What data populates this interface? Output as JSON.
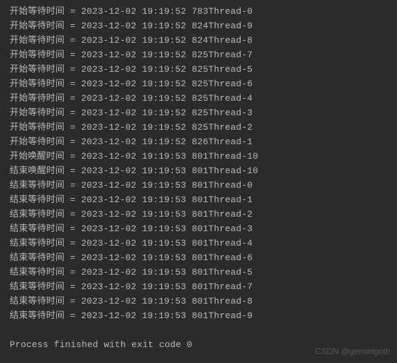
{
  "console": {
    "lines": [
      {
        "label": "开始等待时间",
        "sep": "=",
        "date": "2023-12-02",
        "time": "19:19:52",
        "ms": "783",
        "thread": "Thread-0"
      },
      {
        "label": "开始等待时间",
        "sep": "=",
        "date": "2023-12-02",
        "time": "19:19:52",
        "ms": "824",
        "thread": "Thread-9"
      },
      {
        "label": "开始等待时间",
        "sep": "=",
        "date": "2023-12-02",
        "time": "19:19:52",
        "ms": "824",
        "thread": "Thread-8"
      },
      {
        "label": "开始等待时间",
        "sep": "=",
        "date": "2023-12-02",
        "time": "19:19:52",
        "ms": "825",
        "thread": "Thread-7"
      },
      {
        "label": "开始等待时间",
        "sep": "=",
        "date": "2023-12-02",
        "time": "19:19:52",
        "ms": "825",
        "thread": "Thread-5"
      },
      {
        "label": "开始等待时间",
        "sep": "=",
        "date": "2023-12-02",
        "time": "19:19:52",
        "ms": "825",
        "thread": "Thread-6"
      },
      {
        "label": "开始等待时间",
        "sep": "=",
        "date": "2023-12-02",
        "time": "19:19:52",
        "ms": "825",
        "thread": "Thread-4"
      },
      {
        "label": "开始等待时间",
        "sep": "=",
        "date": "2023-12-02",
        "time": "19:19:52",
        "ms": "825",
        "thread": "Thread-3"
      },
      {
        "label": "开始等待时间",
        "sep": "=",
        "date": "2023-12-02",
        "time": "19:19:52",
        "ms": "825",
        "thread": "Thread-2"
      },
      {
        "label": "开始等待时间",
        "sep": "=",
        "date": "2023-12-02",
        "time": "19:19:52",
        "ms": "826",
        "thread": "Thread-1"
      },
      {
        "label": "开始唤醒时间",
        "sep": "=",
        "date": "2023-12-02",
        "time": "19:19:53",
        "ms": "801",
        "thread": "Thread-10"
      },
      {
        "label": "结束唤醒时间",
        "sep": "=",
        "date": "2023-12-02",
        "time": "19:19:53",
        "ms": "801",
        "thread": "Thread-10"
      },
      {
        "label": "结束等待时间",
        "sep": "=",
        "date": "2023-12-02",
        "time": "19:19:53",
        "ms": "801",
        "thread": "Thread-0"
      },
      {
        "label": "结束等待时间",
        "sep": "=",
        "date": "2023-12-02",
        "time": "19:19:53",
        "ms": "801",
        "thread": "Thread-1"
      },
      {
        "label": "结束等待时间",
        "sep": "=",
        "date": "2023-12-02",
        "time": "19:19:53",
        "ms": "801",
        "thread": "Thread-2"
      },
      {
        "label": "结束等待时间",
        "sep": "=",
        "date": "2023-12-02",
        "time": "19:19:53",
        "ms": "801",
        "thread": "Thread-3"
      },
      {
        "label": "结束等待时间",
        "sep": "=",
        "date": "2023-12-02",
        "time": "19:19:53",
        "ms": "801",
        "thread": "Thread-4"
      },
      {
        "label": "结束等待时间",
        "sep": "=",
        "date": "2023-12-02",
        "time": "19:19:53",
        "ms": "801",
        "thread": "Thread-6"
      },
      {
        "label": "结束等待时间",
        "sep": "=",
        "date": "2023-12-02",
        "time": "19:19:53",
        "ms": "801",
        "thread": "Thread-5"
      },
      {
        "label": "结束等待时间",
        "sep": "=",
        "date": "2023-12-02",
        "time": "19:19:53",
        "ms": "801",
        "thread": "Thread-7"
      },
      {
        "label": "结束等待时间",
        "sep": "=",
        "date": "2023-12-02",
        "time": "19:19:53",
        "ms": "801",
        "thread": "Thread-8"
      },
      {
        "label": "结束等待时间",
        "sep": "=",
        "date": "2023-12-02",
        "time": "19:19:53",
        "ms": "801",
        "thread": "Thread-9"
      }
    ],
    "exit_message": "Process finished with exit code 0"
  },
  "watermark": "CSDN @geminigoth"
}
